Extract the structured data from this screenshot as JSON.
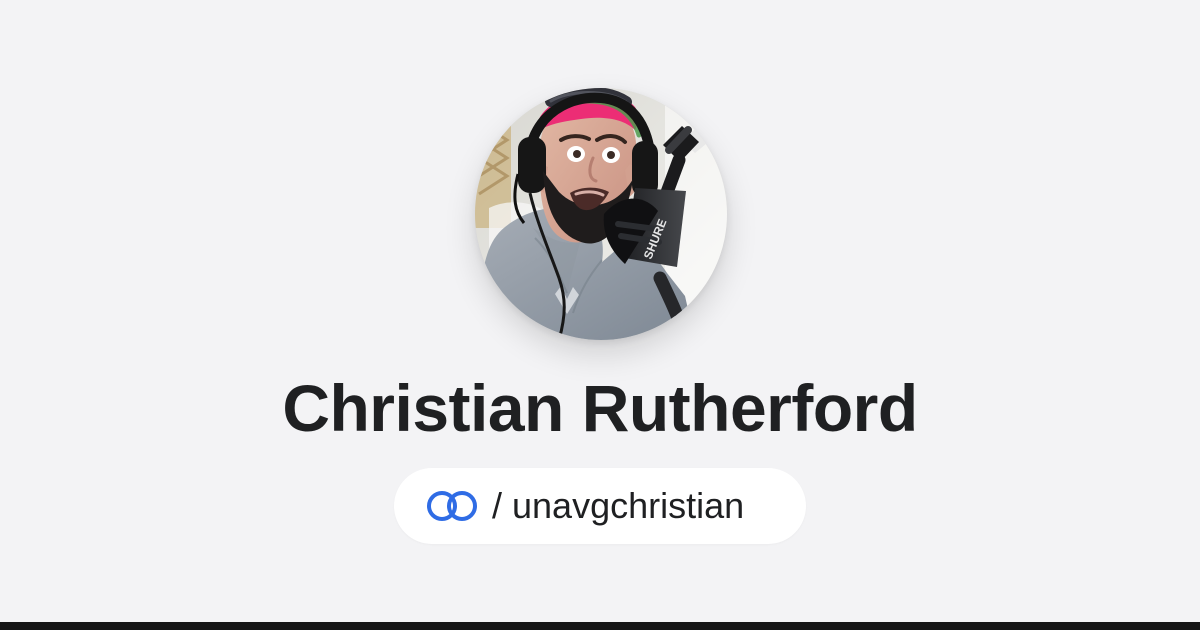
{
  "profile": {
    "name": "Christian Rutherford",
    "separator": "/",
    "handle": "unavgchristian",
    "avatar_icon": "profile-photo",
    "brand_icon": "linked-rings-icon",
    "microphone_label": "SHURE"
  },
  "colors": {
    "background": "#f3f3f5",
    "text": "#1f2022",
    "pill": "#ffffff",
    "accent": "#2f6ce5",
    "bottom_bar": "#151516"
  }
}
